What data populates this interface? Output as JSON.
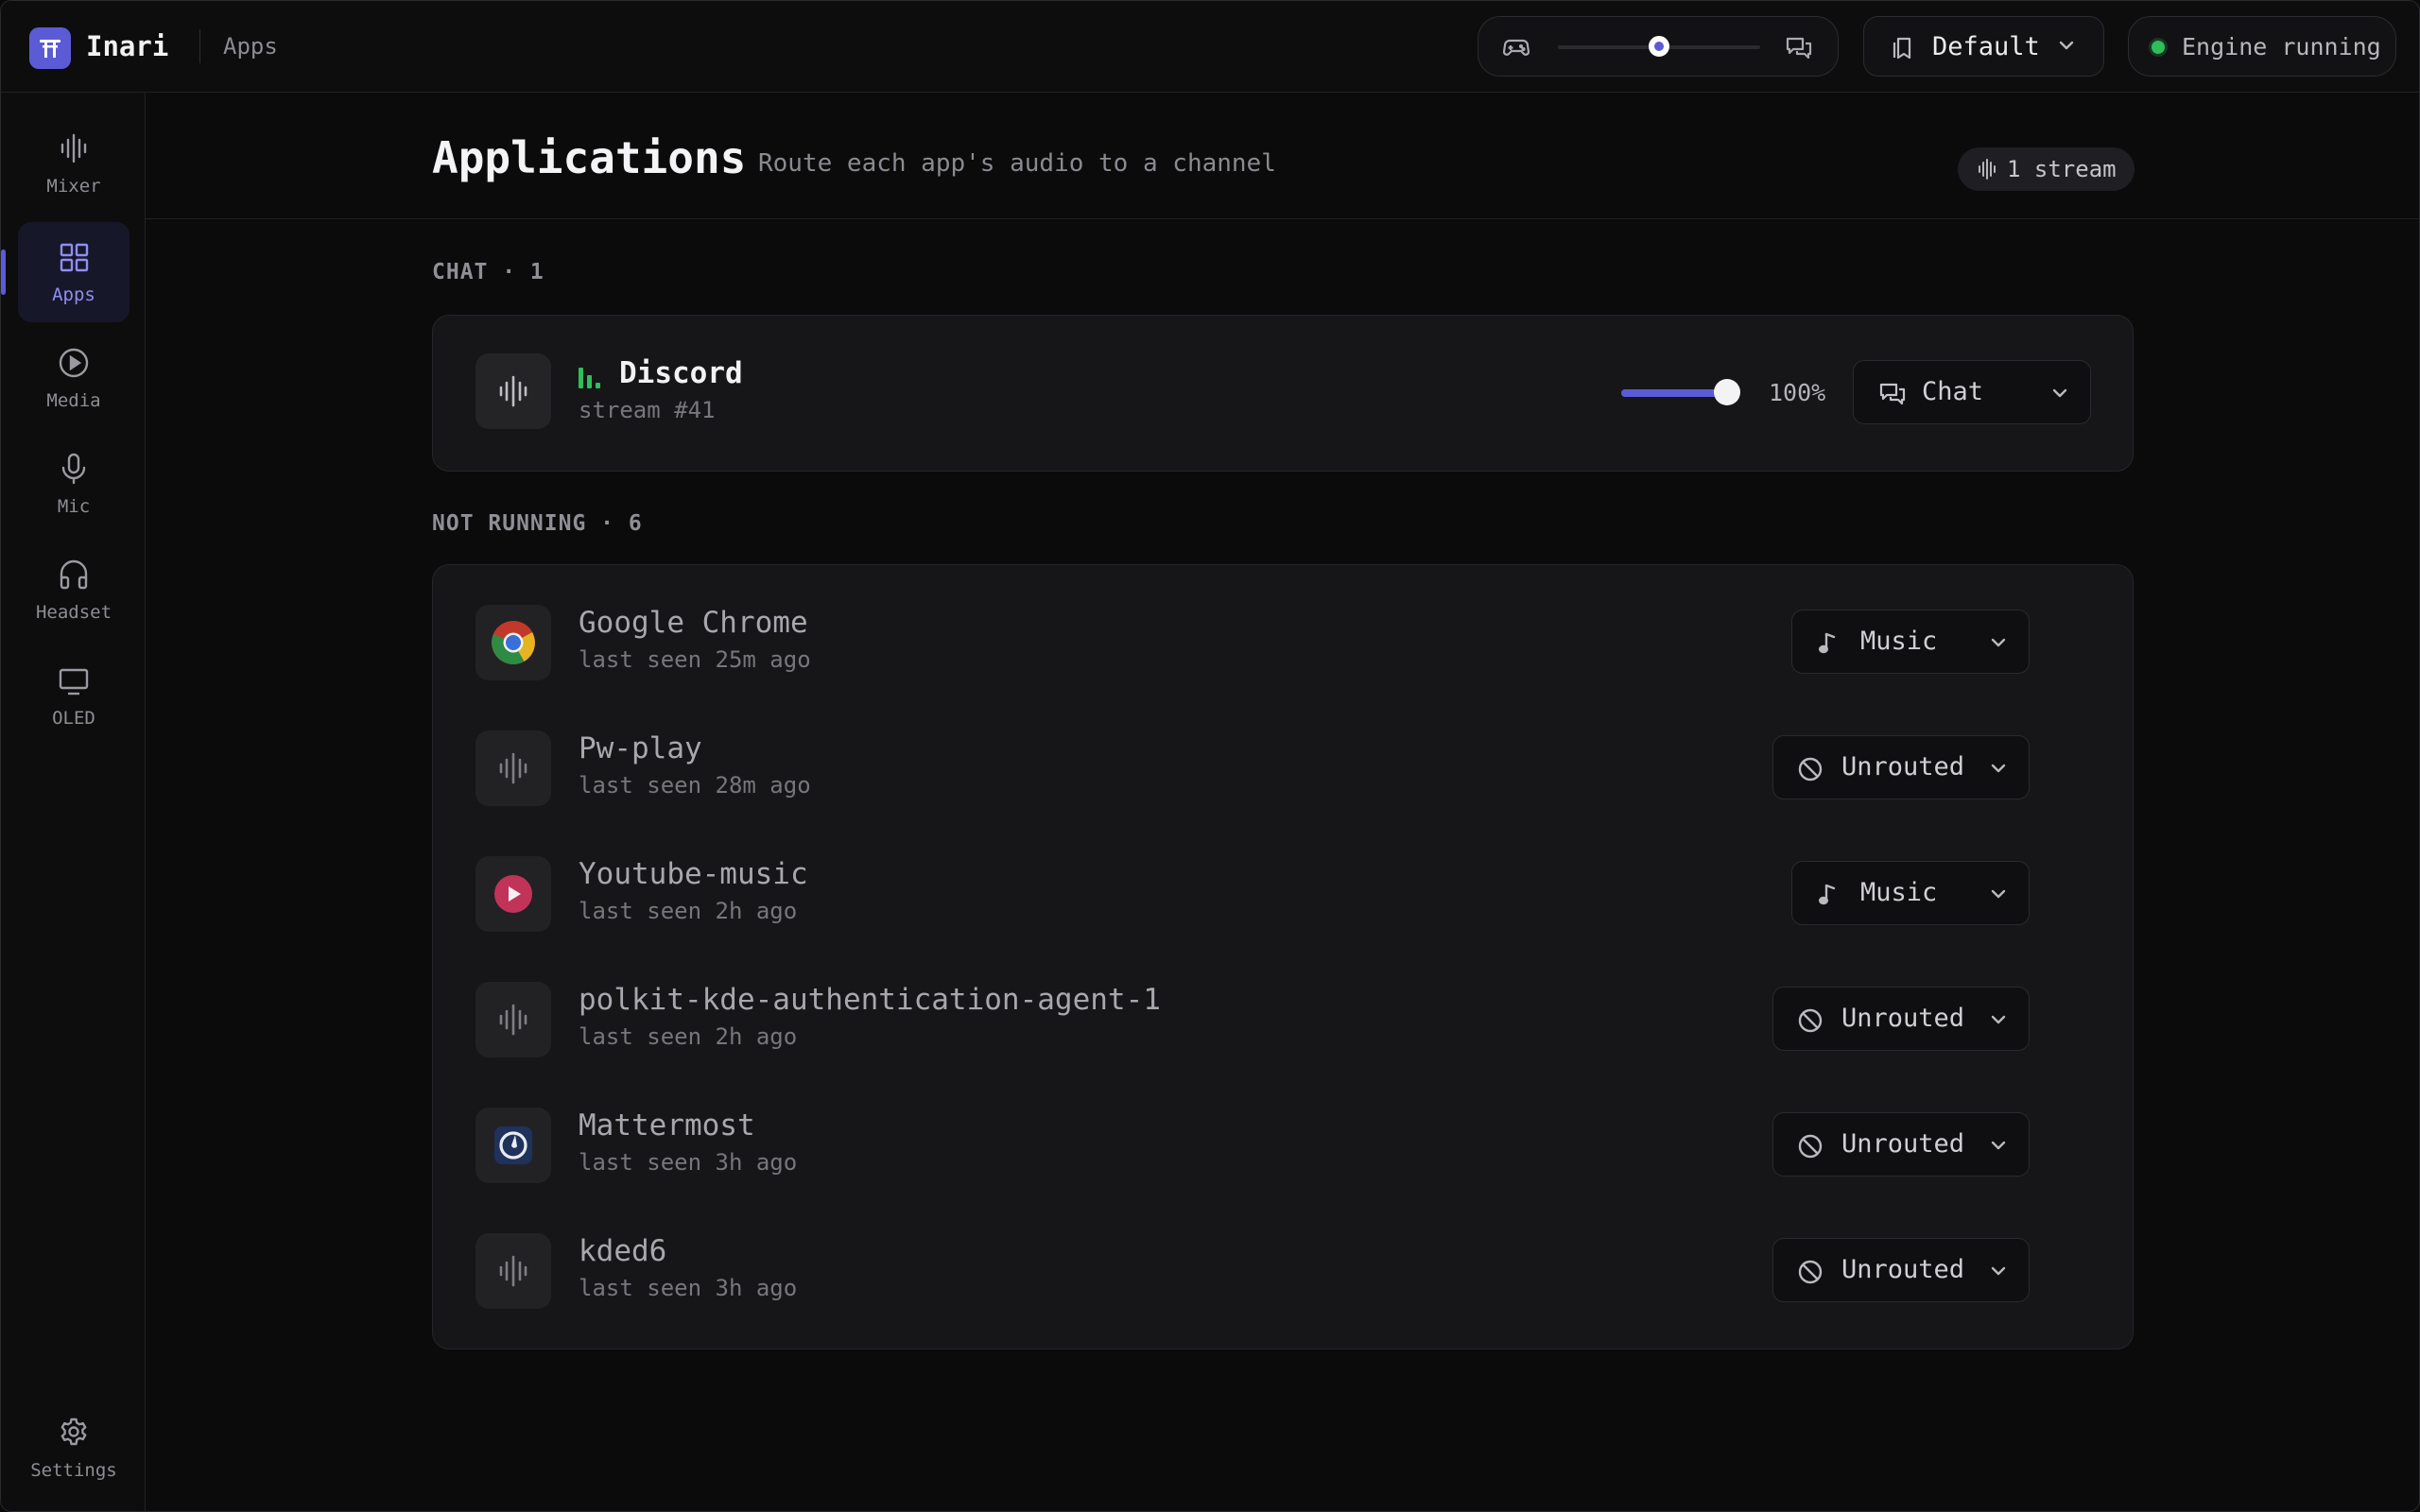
{
  "app": {
    "name": "Inari",
    "breadcrumb": "Apps"
  },
  "topbar": {
    "balance": {
      "left_icon": "gamepad-icon",
      "right_icon": "chat-bubbles-icon",
      "value": 0.5
    },
    "profile": {
      "label": "Default",
      "icon": "bookmarks-icon"
    },
    "engine": {
      "label": "Engine running",
      "status_color": "#2fbf5a"
    }
  },
  "sidebar": {
    "items": [
      {
        "key": "mixer",
        "label": "Mixer",
        "icon": "waveform-icon",
        "active": false
      },
      {
        "key": "apps",
        "label": "Apps",
        "icon": "grid-icon",
        "active": true
      },
      {
        "key": "media",
        "label": "Media",
        "icon": "play-circle-icon",
        "active": false
      },
      {
        "key": "mic",
        "label": "Mic",
        "icon": "microphone-icon",
        "active": false
      },
      {
        "key": "headset",
        "label": "Headset",
        "icon": "headphones-icon",
        "active": false
      },
      {
        "key": "oled",
        "label": "OLED",
        "icon": "monitor-icon",
        "active": false
      }
    ],
    "settings": {
      "label": "Settings",
      "icon": "gear-icon"
    }
  },
  "page": {
    "title": "Applications",
    "subtitle": "Route each app's audio to a channel",
    "stream_badge": "1 stream"
  },
  "sections": {
    "active": {
      "label": "CHAT · 1",
      "app": {
        "name": "Discord",
        "meta": "stream #41",
        "volume": 1.0,
        "volume_label": "100%",
        "channel": "Chat"
      }
    },
    "inactive": {
      "label": "NOT RUNNING · 6",
      "apps": [
        {
          "name": "Google Chrome",
          "meta": "last seen 25m ago",
          "icon": "chrome-icon",
          "channel": "Music",
          "channel_icon": "music-note-icon"
        },
        {
          "name": "Pw-play",
          "meta": "last seen 28m ago",
          "icon": "waveform-icon",
          "channel": "Unrouted",
          "channel_icon": "blocked-icon"
        },
        {
          "name": "Youtube-music",
          "meta": "last seen 2h ago",
          "icon": "youtube-music-icon",
          "channel": "Music",
          "channel_icon": "music-note-icon"
        },
        {
          "name": "polkit-kde-authentication-agent-1",
          "meta": "last seen 2h ago",
          "icon": "waveform-icon",
          "channel": "Unrouted",
          "channel_icon": "blocked-icon"
        },
        {
          "name": "Mattermost",
          "meta": "last seen 3h ago",
          "icon": "mattermost-icon",
          "channel": "Unrouted",
          "channel_icon": "blocked-icon"
        },
        {
          "name": "kded6",
          "meta": "last seen 3h ago",
          "icon": "waveform-icon",
          "channel": "Unrouted",
          "channel_icon": "blocked-icon"
        }
      ]
    }
  },
  "colors": {
    "accent": "#5b5bd6",
    "live": "#2fbf5a",
    "background": "#0a0a0b",
    "card": "#161618"
  }
}
